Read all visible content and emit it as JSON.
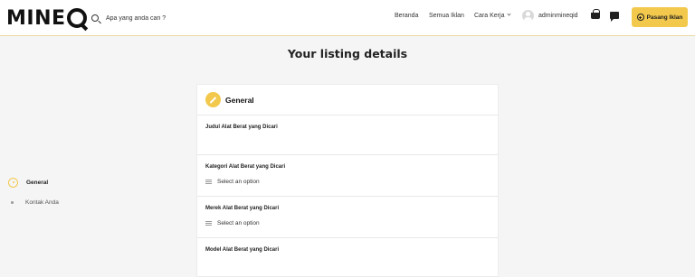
{
  "header": {
    "logo": "MINEQ",
    "search_placeholder": "Apa yang anda cari ?",
    "nav": [
      "Beranda",
      "Semua Iklan",
      "Cara Kerja"
    ],
    "username": "adminmineqid",
    "post_button": "Pasang Iklan",
    "accent_color": "#f2c94c"
  },
  "page": {
    "title": "Your listing details"
  },
  "sidebar": {
    "items": [
      {
        "label": "General",
        "active": true
      },
      {
        "label": "Kontak Anda",
        "active": false
      }
    ]
  },
  "form": {
    "section_title": "General",
    "fields": [
      {
        "label": "Judul Alat Berat yang Dicari"
      },
      {
        "label": "Kategori Alat Berat yang Dicari",
        "select": "Select an option"
      },
      {
        "label": "Merek Alat Berat yang Dicari",
        "select": "Select an option"
      },
      {
        "label": "Model Alat Berat yang Dicari"
      }
    ]
  }
}
